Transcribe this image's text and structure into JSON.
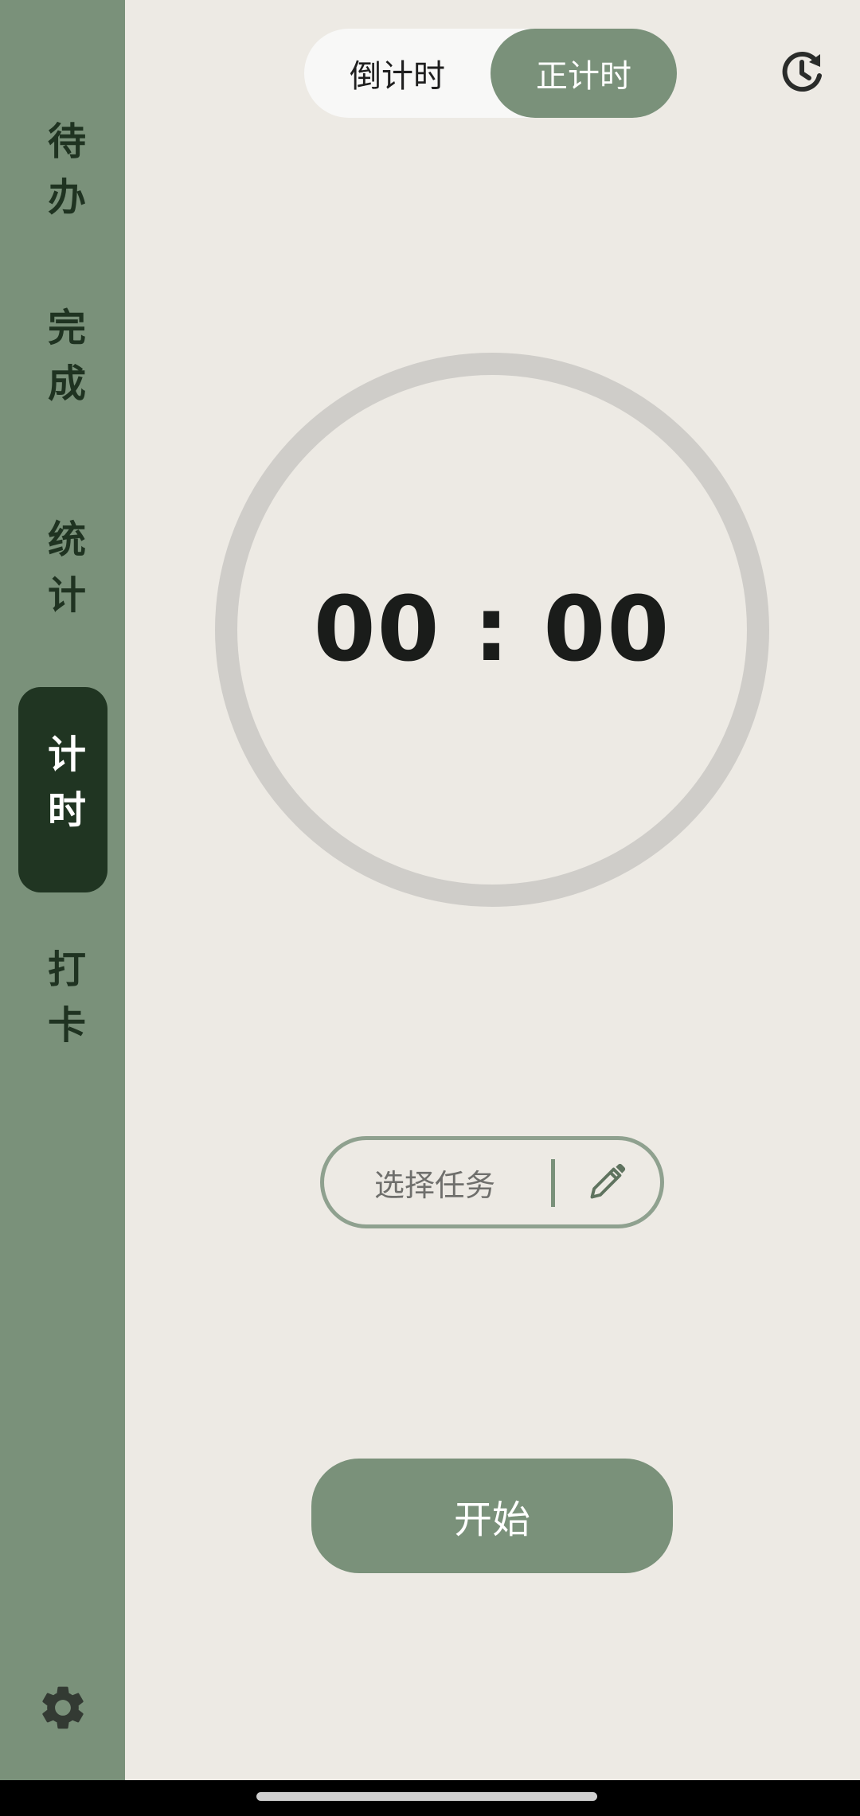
{
  "sidebar": {
    "items": [
      {
        "label": "待办",
        "icon": null
      },
      {
        "label": "完成",
        "icon": null
      },
      {
        "label": "统计",
        "icon": null
      },
      {
        "label": "计时",
        "active": true
      },
      {
        "label": "打卡",
        "icon": null
      }
    ],
    "settings_icon": "gear-icon"
  },
  "mode_toggle": {
    "countdown_label": "倒计时",
    "countup_label": "正计时",
    "selected": "正计时"
  },
  "header": {
    "history_icon": "history-clock-icon"
  },
  "timer": {
    "display": "00 : 00"
  },
  "task": {
    "placeholder": "选择任务",
    "edit_icon": "pencil-icon"
  },
  "actions": {
    "start_label": "开始"
  },
  "colors": {
    "accent": "#7a917a",
    "active_nav": "#203522",
    "background": "#edeae4",
    "ring": "#cfcdc9"
  }
}
